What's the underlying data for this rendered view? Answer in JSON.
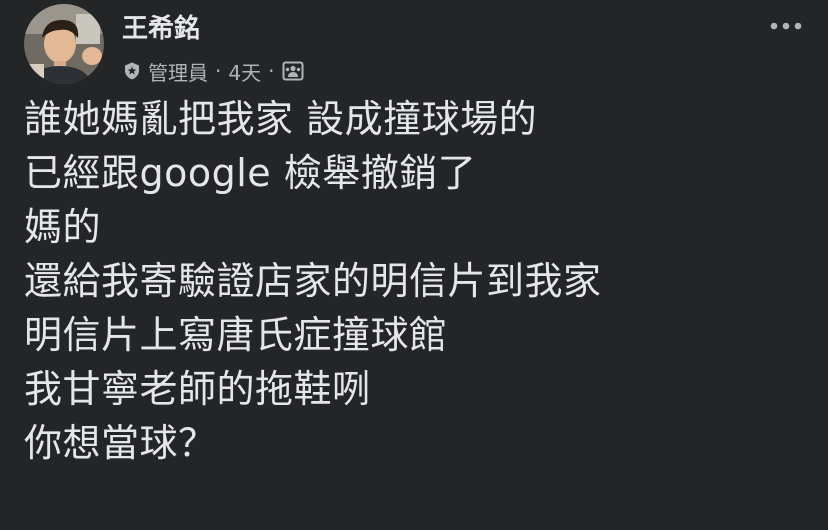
{
  "post": {
    "author": {
      "name": "王希銘",
      "role": "管理員"
    },
    "timestamp": "4天",
    "separator": "·",
    "icons": {
      "avatar": "profile-photo",
      "role_badge": "admin-shield-icon",
      "audience": "audience-group-icon",
      "more": "more-options-icon"
    },
    "message_lines": [
      "誰她媽亂把我家 設成撞球場的",
      "已經跟google 檢舉撤銷了",
      "媽的",
      "還給我寄驗證店家的明信片到我家",
      "明信片上寫唐氏症撞球館",
      "我甘寧老師的拖鞋咧",
      "你想當球？"
    ],
    "colors": {
      "background": "#242526",
      "primary_text": "#e4e6eb",
      "secondary_text": "#b0b3b8"
    }
  }
}
